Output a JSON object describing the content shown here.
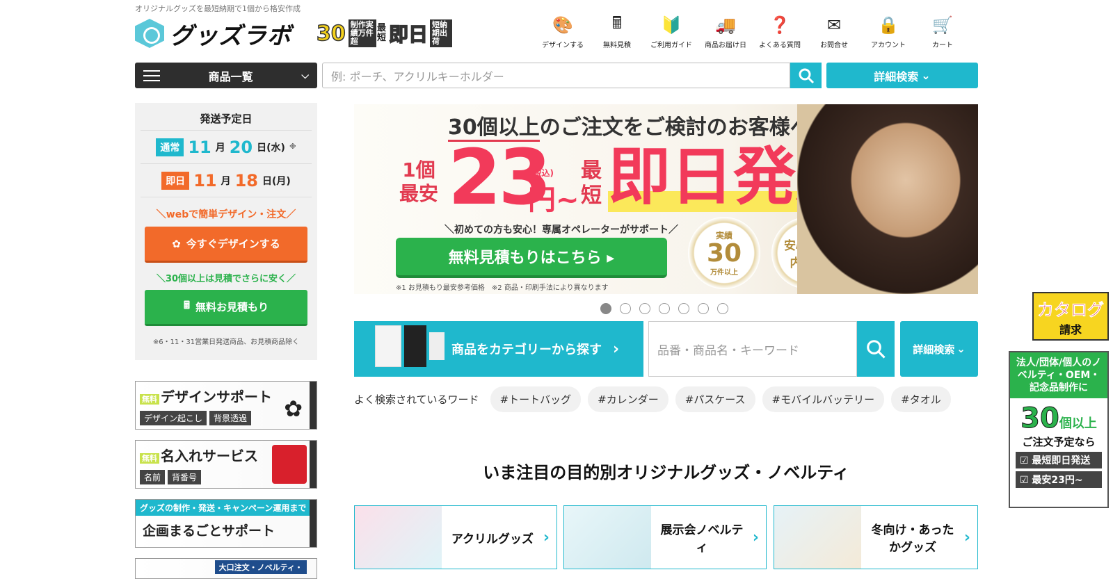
{
  "header": {
    "tagline": "オリジナルグッズを最短納期で1個から格安作成",
    "logo_text": "グッズラボ",
    "badge_30": "30",
    "badge_30_sub": "制作実績万件超",
    "badge_short": "最短",
    "badge_sokujitsu": "即日",
    "badge_sokujitsu_sub": "短納期出荷",
    "nav": [
      {
        "label": "デザインする",
        "icon": "palette-icon",
        "glyph": "🎨"
      },
      {
        "label": "無料見積",
        "icon": "calculator-icon",
        "glyph": "🖩"
      },
      {
        "label": "ご利用ガイド",
        "icon": "beginner-mark-icon",
        "glyph": "🔰"
      },
      {
        "label": "商品お届け日",
        "icon": "truck-icon",
        "glyph": "🚚"
      },
      {
        "label": "よくある質問",
        "icon": "question-icon",
        "glyph": "❓"
      },
      {
        "label": "お問合せ",
        "icon": "mail-icon",
        "glyph": "✉"
      },
      {
        "label": "アカウント",
        "icon": "lock-icon",
        "glyph": "🔒"
      },
      {
        "label": "カート",
        "icon": "cart-icon",
        "glyph": "🛒"
      }
    ]
  },
  "search": {
    "category_label": "商品一覧",
    "placeholder": "例: ポーチ、アクリルキーホルダー",
    "detail_label": "詳細検索"
  },
  "shipping": {
    "title": "発送予定日",
    "normal_tag": "通常",
    "normal_month": "11",
    "normal_day": "20",
    "normal_weekday": "日(水)",
    "normal_mark": "※",
    "same_tag": "即日",
    "same_month": "11",
    "same_day": "18",
    "same_weekday": "日(月)",
    "month_unit": "月",
    "web_note": "＼webで簡単デザイン・注文／",
    "design_button": "今すぐデザインする",
    "quote_note": "＼30個以上は見積でさらに安く／",
    "quote_button": "無料お見積もり",
    "footnote": "※6・11・31営業日発送商品、お見積商品除く"
  },
  "side_banners": {
    "free": "無料",
    "design_title": "デザインサポート",
    "design_chips": [
      "デザイン起こし",
      "背景透過"
    ],
    "name_title": "名入れサービス",
    "name_chips": [
      "名前",
      "背番号"
    ],
    "plan_top": "グッズの制作・発送・キャンペーン運用まで",
    "plan_title": "企画まるごとサポート",
    "bulk_top": "大口注文・ノベルティ・"
  },
  "hero": {
    "headline_underlined": "30個以上",
    "headline_rest": "のご注文をご検討のお客様へ",
    "min_label": "1個最安",
    "price": "23",
    "tax": "(税込)",
    "yen": "円~",
    "short_label": "最短",
    "sokujitsu": "即日発送",
    "note1": "＼初めての方も安心！専属オペレーターがサポート／",
    "cta": "無料見積もりはこちら ▸",
    "footnote": "※1 お見積もり最安参考価格　※2 商品・印刷手法により異なります",
    "medal1_top": "実績",
    "medal1_num": "30",
    "medal1_unit": "万件以上",
    "medal2": "安心の国内生産"
  },
  "carousel": {
    "count": 7,
    "active": 0
  },
  "category_search": {
    "label": "商品をカテゴリーから探す",
    "keyword_placeholder": "品番・商品名・キーワード",
    "detail_label": "詳細検索"
  },
  "popular": {
    "label": "よく検索されているワード",
    "tags": [
      "#トートバッグ",
      "#カレンダー",
      "#パスケース",
      "#モバイルバッテリー",
      "#タオル"
    ]
  },
  "section": {
    "title": "いま注目の目的別オリジナルグッズ・ノベルティ",
    "cards": [
      "アクリルグッズ",
      "展示会ノベルティ",
      "冬向け・あったかグッズ"
    ]
  },
  "float": {
    "catalog": "カタログ",
    "catalog_sub": "請求",
    "corp_top": "法人/団体/個人のノベルティ・OEM・記念品制作に",
    "corp_num": "30",
    "corp_unit": "個以上",
    "corp_sub": "ご注文予定なら",
    "corp_chips": [
      "☑ 最短即日発送",
      "☑ 最安23円~"
    ]
  }
}
